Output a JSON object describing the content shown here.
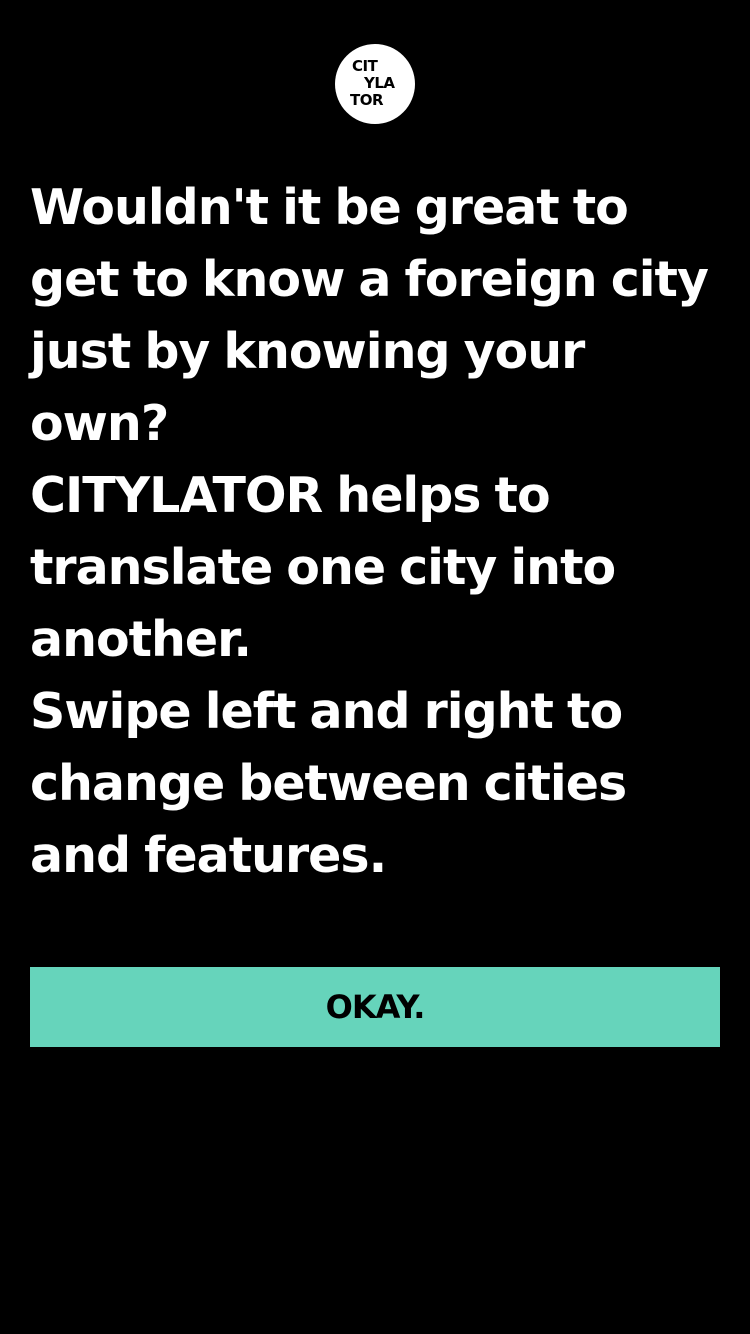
{
  "logo": {
    "line1": "CIT",
    "line2": "YLA",
    "line3": "TOR"
  },
  "intro": {
    "paragraph1": "Wouldn't it be great to get to know a foreign city just by knowing your own?",
    "paragraph2": "CITYLATOR helps to translate one city into another.",
    "paragraph3": "Swipe left and right to change between cities and features."
  },
  "button": {
    "label": "OKAY."
  },
  "colors": {
    "background": "#000000",
    "text": "#ffffff",
    "accent": "#66d4bb"
  }
}
